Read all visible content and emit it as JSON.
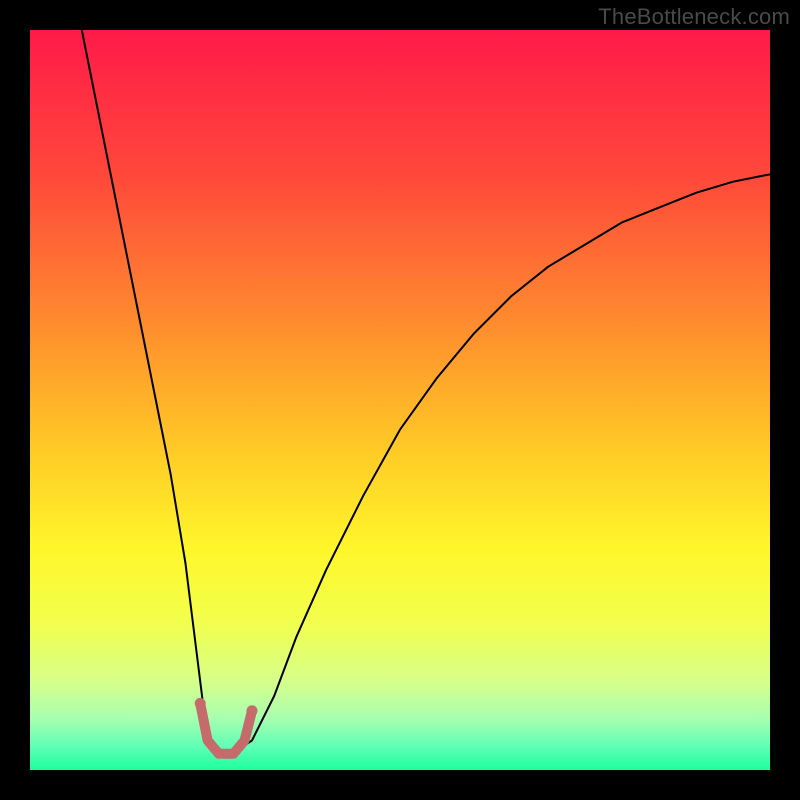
{
  "watermark": "TheBottleneck.com",
  "chart_data": {
    "type": "line",
    "title": "",
    "xlabel": "",
    "ylabel": "",
    "xlim": [
      0,
      100
    ],
    "ylim": [
      0,
      100
    ],
    "grid": false,
    "background": {
      "type": "vertical-gradient",
      "stops": [
        {
          "offset": 0.0,
          "color": "#ff1a49"
        },
        {
          "offset": 0.2,
          "color": "#ff493a"
        },
        {
          "offset": 0.4,
          "color": "#ff8d2e"
        },
        {
          "offset": 0.55,
          "color": "#ffc426"
        },
        {
          "offset": 0.7,
          "color": "#fff62a"
        },
        {
          "offset": 0.8,
          "color": "#f2ff4d"
        },
        {
          "offset": 0.88,
          "color": "#d6ff8a"
        },
        {
          "offset": 0.93,
          "color": "#a8ffb0"
        },
        {
          "offset": 0.97,
          "color": "#5cffb5"
        },
        {
          "offset": 1.0,
          "color": "#1dff9c"
        }
      ]
    },
    "series": [
      {
        "name": "bottleneck-curve",
        "stroke": "#000000",
        "stroke_width": 2,
        "x": [
          7,
          9,
          11,
          13,
          15,
          17,
          19,
          21,
          22,
          23,
          24,
          25,
          27,
          30,
          33,
          36,
          40,
          45,
          50,
          55,
          60,
          65,
          70,
          75,
          80,
          85,
          90,
          95,
          100
        ],
        "y": [
          100,
          90,
          80,
          70,
          60,
          50,
          40,
          28,
          20,
          12,
          4,
          2,
          2,
          4,
          10,
          18,
          27,
          37,
          46,
          53,
          59,
          64,
          68,
          71,
          74,
          76,
          78,
          79.5,
          80.5
        ]
      },
      {
        "name": "notch-markers",
        "type": "marker-path",
        "stroke": "#c56b6b",
        "fill": "#c56b6b",
        "stroke_width": 10,
        "linecap": "round",
        "points": [
          {
            "x": 23.0,
            "y": 9.0
          },
          {
            "x": 24.0,
            "y": 4.0
          },
          {
            "x": 25.5,
            "y": 2.2
          },
          {
            "x": 27.5,
            "y": 2.2
          },
          {
            "x": 29.0,
            "y": 4.0
          },
          {
            "x": 30.0,
            "y": 8.0
          }
        ]
      }
    ]
  }
}
